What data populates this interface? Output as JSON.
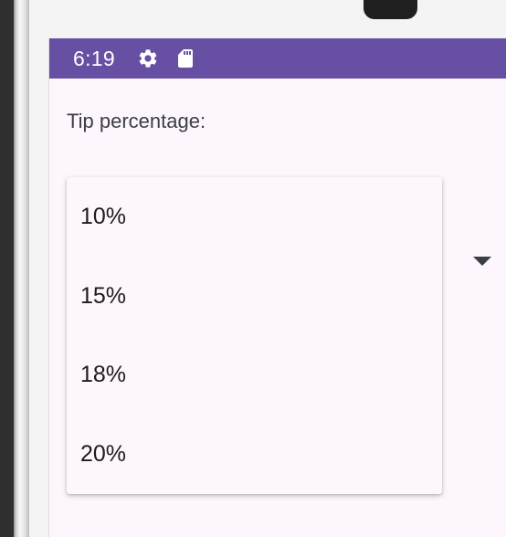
{
  "status_bar": {
    "time": "6:19",
    "icons": [
      "settings-icon",
      "sd-card-icon"
    ],
    "background_color": "#6750a4",
    "text_color": "#ffffff"
  },
  "form": {
    "tip_label": "Tip percentage:"
  },
  "spinner": {
    "arrow_icon": "dropdown-arrow-icon",
    "options": [
      "10%",
      "15%",
      "18%",
      "20%"
    ]
  },
  "theme": {
    "screen_background": "#fdf7fd",
    "text_color": "#1d1b20"
  }
}
